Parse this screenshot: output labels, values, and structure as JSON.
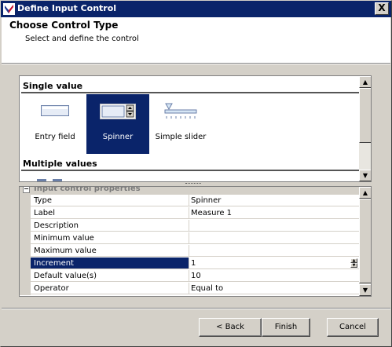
{
  "window": {
    "title": "Define Input Control",
    "close_label": "X"
  },
  "header": {
    "title": "Choose Control Type",
    "subtitle": "Select and define the control"
  },
  "control_types": {
    "single_label": "Single value",
    "multiple_label": "Multiple values",
    "items": [
      {
        "label": "Entry field",
        "icon": "entry-field-icon",
        "selected": false
      },
      {
        "label": "Spinner",
        "icon": "spinner-icon",
        "selected": true
      },
      {
        "label": "Simple slider",
        "icon": "slider-icon",
        "selected": false
      }
    ]
  },
  "properties": {
    "category": "Input control properties",
    "rows": [
      {
        "name": "Type",
        "value": "Spinner",
        "selected": false
      },
      {
        "name": "Label",
        "value": "Measure 1",
        "selected": false
      },
      {
        "name": "Description",
        "value": "",
        "selected": false
      },
      {
        "name": "Minimum value",
        "value": "",
        "selected": false
      },
      {
        "name": "Maximum value",
        "value": "",
        "selected": false
      },
      {
        "name": "Increment",
        "value": "1",
        "selected": true
      },
      {
        "name": "Default value(s)",
        "value": "10",
        "selected": false
      },
      {
        "name": "Operator",
        "value": "Equal to",
        "selected": false
      }
    ]
  },
  "buttons": {
    "back": "< Back",
    "finish": "Finish",
    "cancel": "Cancel"
  },
  "colors": {
    "selection": "#0a246a",
    "dialog": "#d4d0c8"
  }
}
